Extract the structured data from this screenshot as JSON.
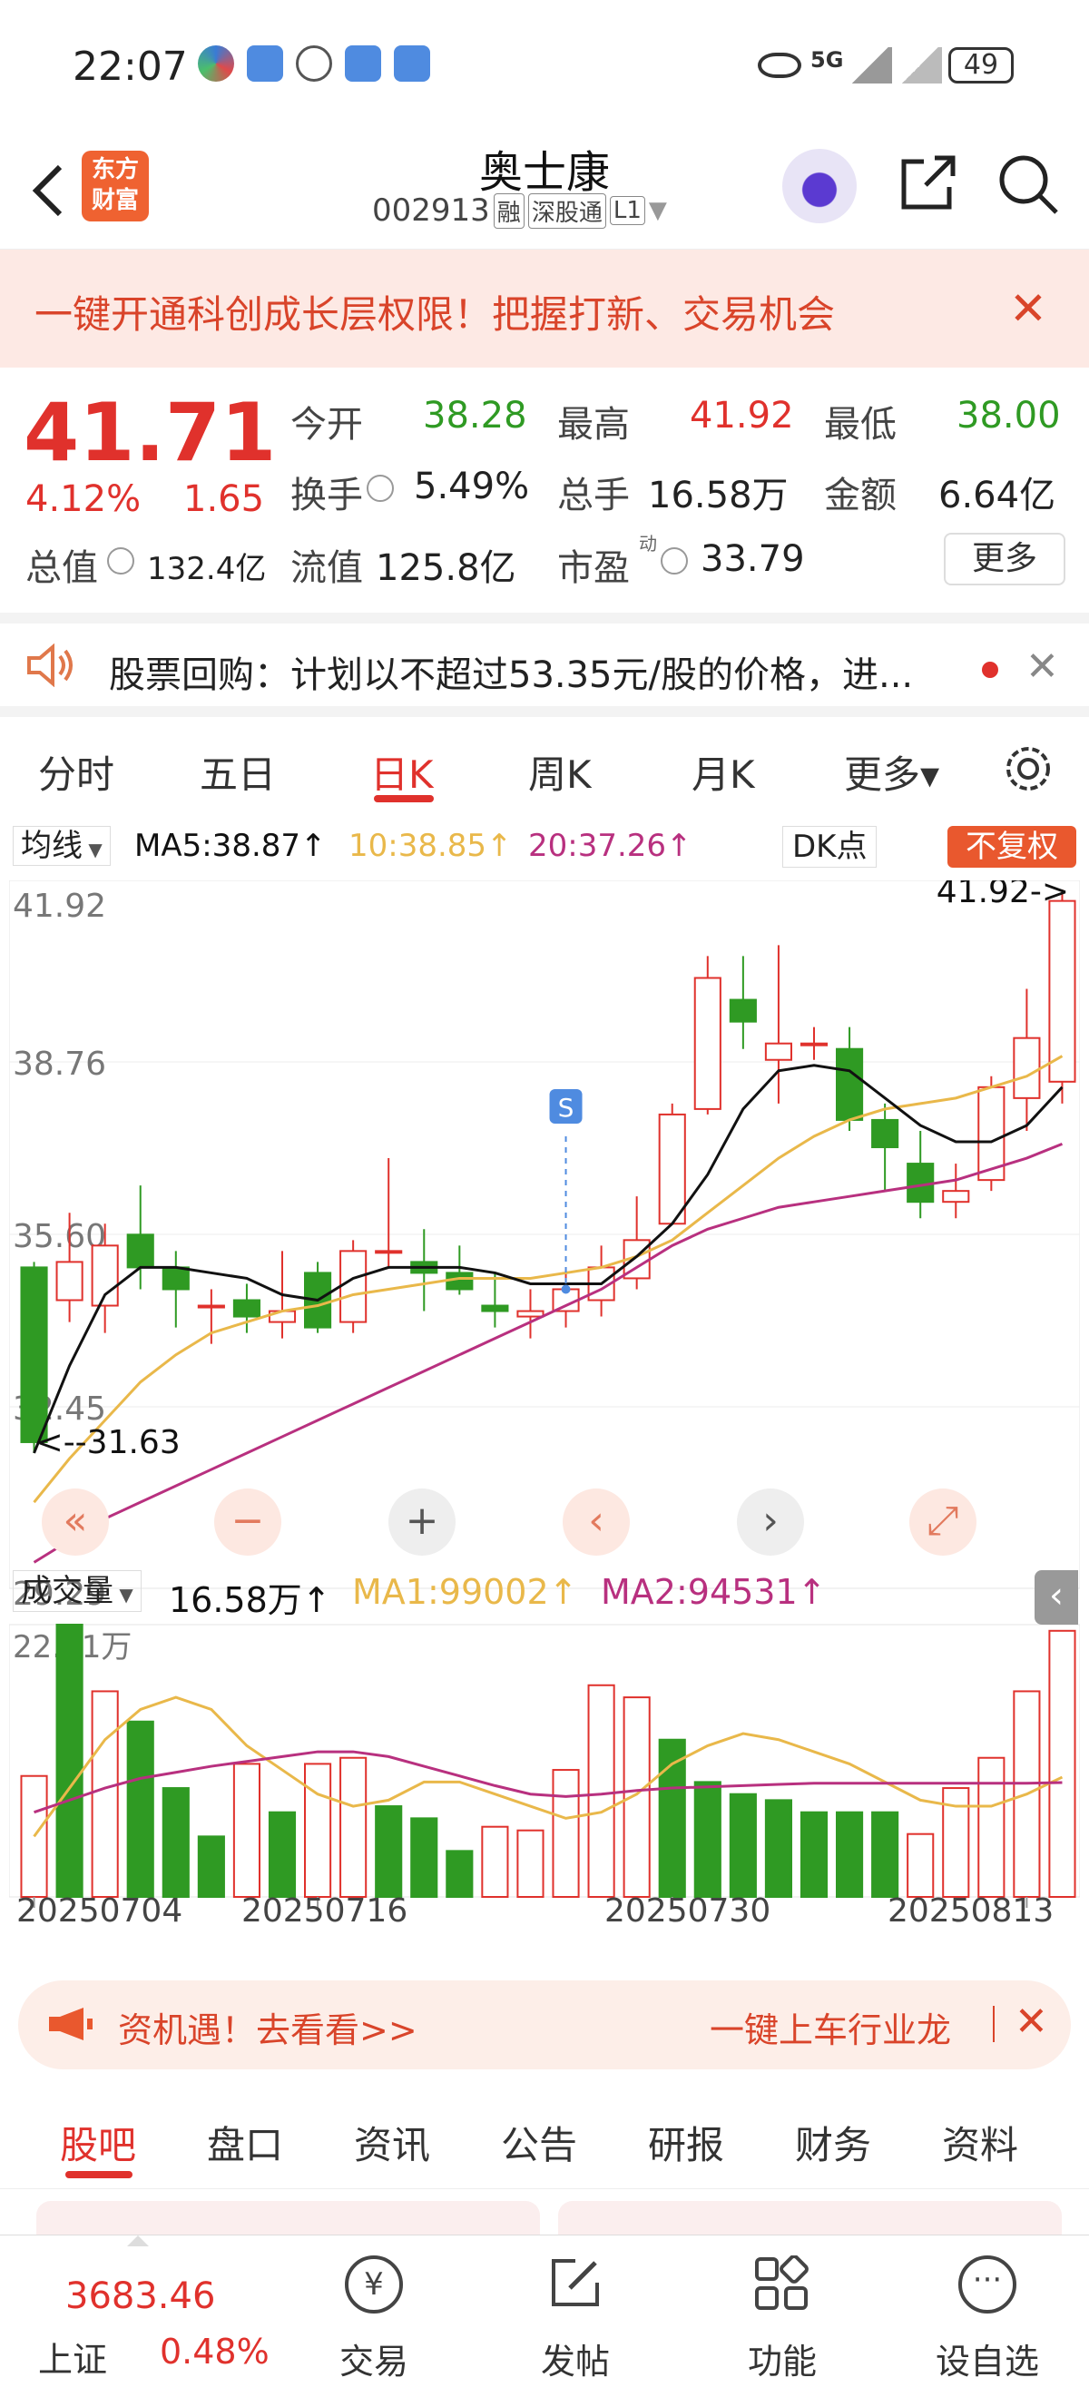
{
  "status_bar": {
    "time": "22:07",
    "network": "5G",
    "battery": "49"
  },
  "header": {
    "title": "奥士康",
    "code": "002913",
    "tags": [
      "融",
      "深股通",
      "L1"
    ],
    "logo_text": "东方财富"
  },
  "promo": {
    "text": "一键开通科创成长层权限！把握打新、交易机会"
  },
  "quote": {
    "price": "41.71",
    "change_pct": "4.12%",
    "change_amt": "1.65",
    "fields": [
      {
        "label": "今开",
        "value": "38.28"
      },
      {
        "label": "最高",
        "value": "41.92"
      },
      {
        "label": "最低",
        "value": "38.00"
      },
      {
        "label": "换手",
        "value": "5.49%"
      },
      {
        "label": "总手",
        "value": "16.58万"
      },
      {
        "label": "金额",
        "value": "6.64亿"
      },
      {
        "label": "总值",
        "value": "132.4亿"
      },
      {
        "label": "流值",
        "value": "125.8亿"
      },
      {
        "label": "市盈",
        "value": "33.79"
      }
    ],
    "pe_sup": "动",
    "more_label": "更多"
  },
  "notice": {
    "text": "股票回购：计划以不超过53.35元/股的价格，进..."
  },
  "tabs": {
    "items": [
      "分时",
      "五日",
      "日K",
      "周K",
      "月K",
      "更多▾"
    ],
    "active_index": 2
  },
  "kline": {
    "indicator_label": "均线",
    "ma5": "MA5:38.87↑",
    "ma10": "10:38.85↑",
    "ma20": "20:37.26↑",
    "dk_label": "DK点",
    "adj_label": "不复权",
    "marker_s": "S",
    "y_labels": [
      "41.92",
      "38.76",
      "35.60",
      "32.45",
      "29.29"
    ],
    "high_marker": "41.92->",
    "low_marker": "<--31.63",
    "colors": {
      "ma5": "#111111",
      "ma10": "#e9b84a",
      "ma20": "#b8307f",
      "up": "#e0312c",
      "down": "#2f9a23"
    }
  },
  "volume": {
    "label": "成交量",
    "value": "16.58万↑",
    "ma1": "MA1:99002↑",
    "ma2": "MA2:94531↑",
    "max_label": "22.51万"
  },
  "dates": [
    "20250704",
    "20250716",
    "20250730",
    "20250813"
  ],
  "chart_data": {
    "type": "candlestick",
    "ylim": [
      29.29,
      41.92
    ],
    "candles": [
      {
        "o": 35.0,
        "c": 31.8,
        "h": 35.1,
        "l": 31.6
      },
      {
        "o": 34.4,
        "c": 35.1,
        "h": 36.0,
        "l": 34.0
      },
      {
        "o": 34.3,
        "c": 35.4,
        "h": 35.8,
        "l": 33.8
      },
      {
        "o": 35.6,
        "c": 35.0,
        "h": 36.5,
        "l": 34.6
      },
      {
        "o": 35.0,
        "c": 34.6,
        "h": 35.3,
        "l": 33.9
      },
      {
        "o": 34.3,
        "c": 34.3,
        "h": 34.6,
        "l": 33.6
      },
      {
        "o": 34.4,
        "c": 34.1,
        "h": 34.7,
        "l": 33.8
      },
      {
        "o": 34.0,
        "c": 34.2,
        "h": 35.3,
        "l": 33.7
      },
      {
        "o": 34.9,
        "c": 33.9,
        "h": 35.1,
        "l": 33.8
      },
      {
        "o": 34.0,
        "c": 35.3,
        "h": 35.5,
        "l": 33.8
      },
      {
        "o": 35.3,
        "c": 35.3,
        "h": 37.0,
        "l": 35.0
      },
      {
        "o": 35.1,
        "c": 34.9,
        "h": 35.7,
        "l": 34.2
      },
      {
        "o": 34.9,
        "c": 34.6,
        "h": 35.4,
        "l": 34.5
      },
      {
        "o": 34.3,
        "c": 34.2,
        "h": 34.9,
        "l": 33.9
      },
      {
        "o": 34.1,
        "c": 34.2,
        "h": 34.6,
        "l": 33.7
      },
      {
        "o": 34.2,
        "c": 34.6,
        "h": 35.0,
        "l": 33.9
      },
      {
        "o": 34.4,
        "c": 35.0,
        "h": 35.4,
        "l": 34.1
      },
      {
        "o": 34.8,
        "c": 35.5,
        "h": 36.3,
        "l": 34.6
      },
      {
        "o": 35.8,
        "c": 37.8,
        "h": 38.0,
        "l": 35.8
      },
      {
        "o": 37.9,
        "c": 40.3,
        "h": 40.7,
        "l": 37.8
      },
      {
        "o": 39.9,
        "c": 39.5,
        "h": 40.7,
        "l": 39.0
      },
      {
        "o": 38.8,
        "c": 39.1,
        "h": 40.9,
        "l": 38.0
      },
      {
        "o": 39.1,
        "c": 39.1,
        "h": 39.4,
        "l": 38.8
      },
      {
        "o": 39.0,
        "c": 37.7,
        "h": 39.4,
        "l": 37.5
      },
      {
        "o": 37.7,
        "c": 37.2,
        "h": 38.0,
        "l": 36.4
      },
      {
        "o": 36.9,
        "c": 36.2,
        "h": 37.5,
        "l": 35.9
      },
      {
        "o": 36.2,
        "c": 36.4,
        "h": 36.9,
        "l": 35.9
      },
      {
        "o": 36.6,
        "c": 38.3,
        "h": 38.5,
        "l": 36.4
      },
      {
        "o": 38.1,
        "c": 39.2,
        "h": 40.1,
        "l": 37.5
      },
      {
        "o": 38.4,
        "c": 41.71,
        "h": 41.92,
        "l": 38.0
      }
    ],
    "ma5": [
      31.6,
      33.2,
      34.5,
      35.0,
      35.0,
      34.9,
      34.8,
      34.5,
      34.4,
      34.8,
      35.0,
      35.0,
      35.0,
      34.9,
      34.7,
      34.7,
      34.7,
      35.2,
      35.8,
      36.7,
      37.9,
      38.6,
      38.7,
      38.6,
      38.1,
      37.6,
      37.3,
      37.3,
      37.6,
      38.3
    ],
    "ma10": [
      30.7,
      31.5,
      32.2,
      32.9,
      33.4,
      33.8,
      34.0,
      34.2,
      34.3,
      34.5,
      34.6,
      34.7,
      34.8,
      34.8,
      34.8,
      34.9,
      35.0,
      35.2,
      35.5,
      36.0,
      36.5,
      37.0,
      37.4,
      37.7,
      37.9,
      38.0,
      38.1,
      38.3,
      38.5,
      38.87
    ],
    "ma20": [
      29.6,
      30.0,
      30.4,
      30.7,
      31.0,
      31.3,
      31.6,
      31.9,
      32.2,
      32.5,
      32.8,
      33.1,
      33.4,
      33.7,
      34.0,
      34.3,
      34.6,
      35.0,
      35.4,
      35.7,
      35.9,
      36.1,
      36.2,
      36.3,
      36.4,
      36.5,
      36.6,
      36.8,
      37.0,
      37.26
    ],
    "volume_max": 22.51,
    "volume": [
      10.0,
      22.51,
      17.0,
      14.5,
      9.0,
      5.0,
      11.0,
      7.0,
      11.0,
      11.5,
      7.5,
      6.5,
      3.8,
      5.8,
      5.5,
      10.5,
      17.5,
      16.5,
      13.0,
      9.5,
      8.5,
      8.0,
      7.0,
      7.0,
      7.0,
      5.2,
      9.0,
      11.5,
      17.0,
      22.0
    ],
    "volume_up": [
      true,
      false,
      true,
      false,
      false,
      false,
      true,
      false,
      true,
      true,
      false,
      false,
      false,
      true,
      true,
      true,
      true,
      true,
      false,
      false,
      false,
      false,
      false,
      false,
      false,
      true,
      true,
      true,
      true,
      true
    ],
    "vol_ma1": [
      5.0,
      9.0,
      13.0,
      15.5,
      16.5,
      15.5,
      12.5,
      10.5,
      8.5,
      7.5,
      8.0,
      9.5,
      9.5,
      8.5,
      7.5,
      6.5,
      7.0,
      8.5,
      11.0,
      12.5,
      13.5,
      13.0,
      12.0,
      11.0,
      9.5,
      8.0,
      7.5,
      7.5,
      8.5,
      9.9
    ],
    "vol_ma2": [
      7.0,
      8.0,
      9.0,
      9.8,
      10.3,
      10.8,
      11.2,
      11.6,
      12.0,
      12.0,
      11.6,
      10.8,
      10.0,
      9.2,
      8.5,
      8.3,
      8.5,
      8.8,
      9.0,
      9.1,
      9.2,
      9.3,
      9.4,
      9.4,
      9.4,
      9.4,
      9.4,
      9.4,
      9.4,
      9.45
    ]
  },
  "chart_controls": [
    "«",
    "−",
    "+",
    "‹",
    "›",
    "⤢"
  ],
  "ad": {
    "left": "资机遇！去看看>>",
    "right": "一键上车行业龙"
  },
  "bottom_tabs": {
    "items": [
      "股吧",
      "盘口",
      "资讯",
      "公告",
      "研报",
      "财务",
      "资料"
    ],
    "active_index": 0
  },
  "footer": {
    "index_value": "3683.46",
    "index_name": "上证",
    "index_pct": "0.48%",
    "items": [
      "交易",
      "发帖",
      "功能",
      "设自选"
    ]
  }
}
